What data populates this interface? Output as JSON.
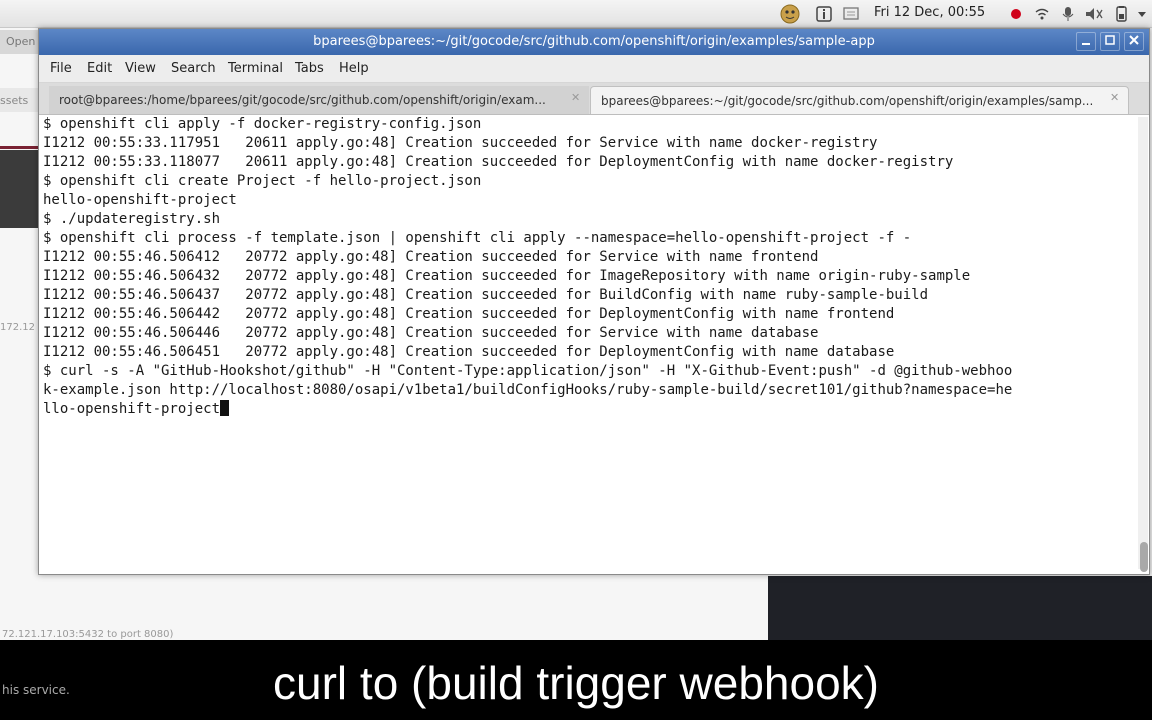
{
  "system_panel": {
    "clock": "Fri 12 Dec, 00:55",
    "icons": [
      "avatar-icon",
      "info-icon",
      "screen-icon",
      "record-icon",
      "wifi-icon",
      "mic-icon",
      "volume-icon",
      "battery-icon",
      "dropdown-icon"
    ]
  },
  "background_window": {
    "title": "Open",
    "tab_text": "ssets",
    "side_ip": "172.12",
    "footer_text": "72.121.17.103:5432 to port 8080)",
    "service_text": "his service."
  },
  "terminal": {
    "title": "bparees@bparees:~/git/gocode/src/github.com/openshift/origin/examples/sample-app",
    "menu": [
      "File",
      "Edit",
      "View",
      "Search",
      "Terminal",
      "Tabs",
      "Help"
    ],
    "tabs": [
      {
        "label": "root@bparees:/home/bparees/git/gocode/src/github.com/openshift/origin/exam...",
        "active": false
      },
      {
        "label": "bparees@bparees:~/git/gocode/src/github.com/openshift/origin/examples/samp...",
        "active": true
      }
    ],
    "lines": [
      "$ openshift cli apply -f docker-registry-config.json",
      "I1212 00:55:33.117951   20611 apply.go:48] Creation succeeded for Service with name docker-registry",
      "I1212 00:55:33.118077   20611 apply.go:48] Creation succeeded for DeploymentConfig with name docker-registry",
      "$ openshift cli create Project -f hello-project.json",
      "hello-openshift-project",
      "$ ./updateregistry.sh",
      "$ openshift cli process -f template.json | openshift cli apply --namespace=hello-openshift-project -f -",
      "I1212 00:55:46.506412   20772 apply.go:48] Creation succeeded for Service with name frontend",
      "I1212 00:55:46.506432   20772 apply.go:48] Creation succeeded for ImageRepository with name origin-ruby-sample",
      "I1212 00:55:46.506437   20772 apply.go:48] Creation succeeded for BuildConfig with name ruby-sample-build",
      "I1212 00:55:46.506442   20772 apply.go:48] Creation succeeded for DeploymentConfig with name frontend",
      "I1212 00:55:46.506446   20772 apply.go:48] Creation succeeded for Service with name database",
      "I1212 00:55:46.506451   20772 apply.go:48] Creation succeeded for DeploymentConfig with name database",
      "$ curl -s -A \"GitHub-Hookshot/github\" -H \"Content-Type:application/json\" -H \"X-Github-Event:push\" -d @github-webhoo",
      "k-example.json http://localhost:8080/osapi/v1beta1/buildConfigHooks/ruby-sample-build/secret101/github?namespace=he",
      "llo-openshift-project"
    ]
  },
  "caption": "curl to (build trigger webhook)"
}
